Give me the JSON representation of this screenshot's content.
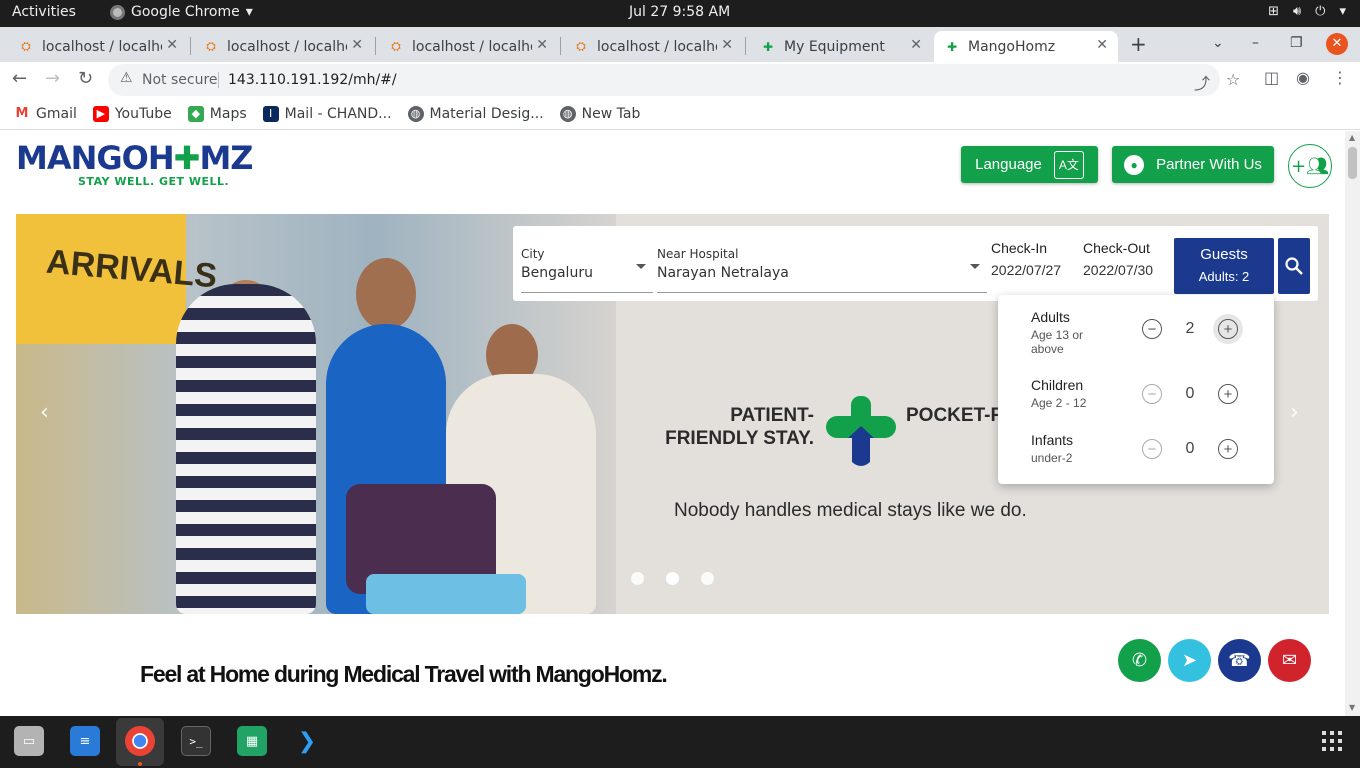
{
  "system": {
    "activities": "Activities",
    "app_name": "Google Chrome",
    "clock": "Jul 27   9:58 AM"
  },
  "tabs": [
    {
      "label": "localhost / localhost"
    },
    {
      "label": "localhost / localhost"
    },
    {
      "label": "localhost / localhost"
    },
    {
      "label": "localhost / localhost"
    },
    {
      "label": "My Equipment"
    },
    {
      "label": "MangoHomz"
    }
  ],
  "omnibox": {
    "security": "Not secure",
    "url": "143.110.191.192/mh/#/"
  },
  "bookmarks": [
    {
      "label": "Gmail"
    },
    {
      "label": "YouTube"
    },
    {
      "label": "Maps"
    },
    {
      "label": "Mail - CHAND..."
    },
    {
      "label": "Material Desig..."
    },
    {
      "label": "New Tab"
    }
  ],
  "site": {
    "logo_text_1": "MANGOH",
    "logo_text_2": "MZ",
    "tagline": "STAY WELL. GET WELL.",
    "language_label": "Language",
    "partner_label": "Partner With Us"
  },
  "hero": {
    "arrivals": "ARRIVALS",
    "slogan_left": "PATIENT-FRIENDLY STAY.",
    "slogan_right": "POCKET-FRIENDLY BUDGET.",
    "tagline": "Nobody handles medical stays like we do."
  },
  "search": {
    "city_label": "City",
    "city_value": "Bengaluru",
    "hospital_label": "Near Hospital",
    "hospital_value": "Narayan Netralaya",
    "checkin_label": "Check-In",
    "checkin_value": "2022/07/27",
    "checkout_label": "Check-Out",
    "checkout_value": "2022/07/30",
    "guests_label": "Guests",
    "guests_summary": "Adults: 2"
  },
  "guest_menu": {
    "adults_title": "Adults",
    "adults_sub": "Age 13 or above",
    "adults_count": "2",
    "children_title": "Children",
    "children_sub": "Age 2 - 12",
    "children_count": "0",
    "infants_title": "Infants",
    "infants_sub": "under-2",
    "infants_count": "0"
  },
  "content": {
    "headline": "Feel at Home during Medical Travel with MangoHomz."
  },
  "colors": {
    "brand_green": "#12a14a",
    "brand_blue": "#1b3a8f"
  }
}
